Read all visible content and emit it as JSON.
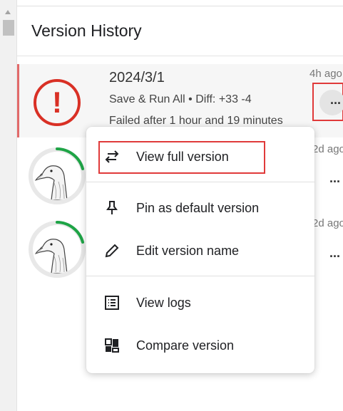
{
  "panel": {
    "title": "Version History"
  },
  "versions": [
    {
      "status": "failed",
      "date": "2024/3/1",
      "meta": "Save & Run All • Diff: +33 -4",
      "status_text": "Failed after 1 hour and 19 minutes",
      "time_ago": "4h ago",
      "status_icon": "error-icon"
    },
    {
      "time_ago": "2d ago",
      "avatar_icon": "goose-avatar-icon"
    },
    {
      "time_ago": "2d ago",
      "avatar_icon": "goose-avatar-icon"
    }
  ],
  "menu": {
    "items": [
      {
        "label": "View full version",
        "icon": "swap-arrows-icon"
      },
      {
        "label": "Pin as default version",
        "icon": "pin-icon"
      },
      {
        "label": "Edit version name",
        "icon": "pencil-icon"
      },
      {
        "label": "View logs",
        "icon": "list-icon"
      },
      {
        "label": "Compare version",
        "icon": "compare-icon"
      }
    ]
  },
  "colors": {
    "error": "#d93025",
    "highlight": "#e03a3a",
    "progress": "#1ea446"
  }
}
